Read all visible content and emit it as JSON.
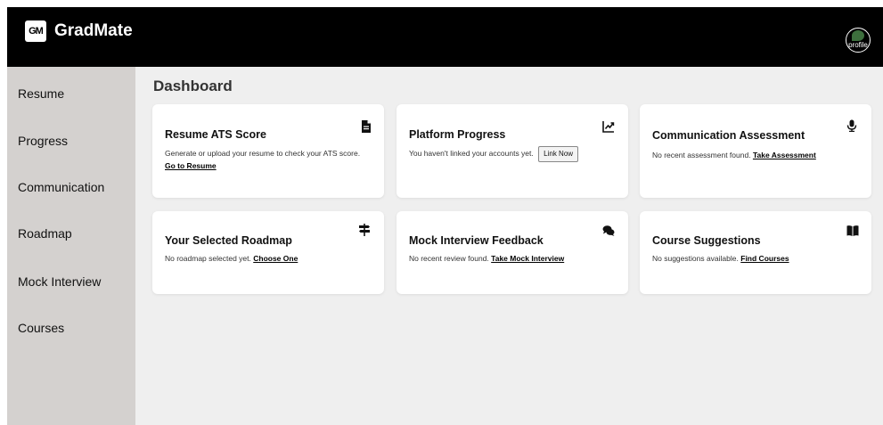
{
  "app": {
    "logo_text": "GM",
    "name": "GradMate",
    "profile_label": "profile"
  },
  "sidebar": {
    "items": [
      {
        "label": "Resume"
      },
      {
        "label": "Progress"
      },
      {
        "label": "Communication"
      },
      {
        "label": "Roadmap"
      },
      {
        "label": "Mock Interview"
      },
      {
        "label": "Courses"
      }
    ]
  },
  "main": {
    "title": "Dashboard",
    "cards": [
      {
        "title": "Resume ATS Score",
        "icon": "document-icon",
        "text": "Generate or upload your resume to check your ATS score.",
        "link": "Go to Resume"
      },
      {
        "title": "Platform Progress",
        "icon": "chart-line-icon",
        "text": "You haven't linked your accounts yet.",
        "button": "Link Now"
      },
      {
        "title": "Communication Assessment",
        "icon": "microphone-icon",
        "text": "No recent assessment found.",
        "link": "Take Assessment"
      },
      {
        "title": "Your Selected Roadmap",
        "icon": "signpost-icon",
        "text": "No roadmap selected yet.",
        "link": "Choose One"
      },
      {
        "title": "Mock Interview Feedback",
        "icon": "chat-bubbles-icon",
        "text": "No recent review found.",
        "link": "Take Mock Interview"
      },
      {
        "title": "Course Suggestions",
        "icon": "book-icon",
        "text": "No suggestions available.",
        "link": "Find Courses"
      }
    ]
  }
}
